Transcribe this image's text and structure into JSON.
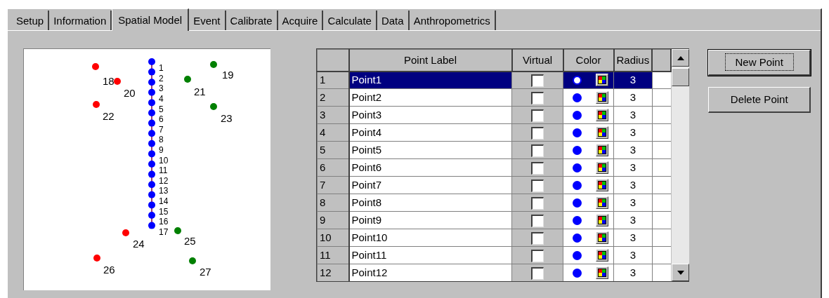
{
  "tabs": [
    {
      "label": "Setup",
      "selected": false
    },
    {
      "label": "Information",
      "selected": false
    },
    {
      "label": "Spatial Model",
      "selected": true
    },
    {
      "label": "Event",
      "selected": false
    },
    {
      "label": "Calibrate",
      "selected": false
    },
    {
      "label": "Acquire",
      "selected": false
    },
    {
      "label": "Calculate",
      "selected": false
    },
    {
      "label": "Data",
      "selected": false
    },
    {
      "label": "Anthropometrics",
      "selected": false
    }
  ],
  "model_view": {
    "points": [
      {
        "label": "1",
        "color": "#0000ff"
      },
      {
        "label": "2",
        "color": "#0000ff"
      },
      {
        "label": "3",
        "color": "#0000ff"
      },
      {
        "label": "4",
        "color": "#0000ff"
      },
      {
        "label": "5",
        "color": "#0000ff"
      },
      {
        "label": "6",
        "color": "#0000ff"
      },
      {
        "label": "7",
        "color": "#0000ff"
      },
      {
        "label": "8",
        "color": "#0000ff"
      },
      {
        "label": "9",
        "color": "#0000ff"
      },
      {
        "label": "10",
        "color": "#0000ff"
      },
      {
        "label": "11",
        "color": "#0000ff"
      },
      {
        "label": "12",
        "color": "#0000ff"
      },
      {
        "label": "13",
        "color": "#0000ff"
      },
      {
        "label": "14",
        "color": "#0000ff"
      },
      {
        "label": "15",
        "color": "#0000ff"
      },
      {
        "label": "16",
        "color": "#0000ff"
      },
      {
        "label": "17",
        "color": "#0000ff"
      },
      {
        "label": "18",
        "color": "#ff0000"
      },
      {
        "label": "19",
        "color": "#008000"
      },
      {
        "label": "20",
        "color": "#ff0000"
      },
      {
        "label": "21",
        "color": "#008000"
      },
      {
        "label": "22",
        "color": "#ff0000"
      },
      {
        "label": "23",
        "color": "#008000"
      },
      {
        "label": "24",
        "color": "#ff0000"
      },
      {
        "label": "25",
        "color": "#008000"
      },
      {
        "label": "26",
        "color": "#ff0000"
      },
      {
        "label": "27",
        "color": "#008000"
      }
    ]
  },
  "grid": {
    "columns": [
      "Point Label",
      "Virtual",
      "Color",
      "Radius"
    ],
    "rows": [
      {
        "number": "1",
        "label": "Point1",
        "virtual": false,
        "color": "#0000ff",
        "radius": "3",
        "selected": true
      },
      {
        "number": "2",
        "label": "Point2",
        "virtual": false,
        "color": "#0000ff",
        "radius": "3",
        "selected": false
      },
      {
        "number": "3",
        "label": "Point3",
        "virtual": false,
        "color": "#0000ff",
        "radius": "3",
        "selected": false
      },
      {
        "number": "4",
        "label": "Point4",
        "virtual": false,
        "color": "#0000ff",
        "radius": "3",
        "selected": false
      },
      {
        "number": "5",
        "label": "Point5",
        "virtual": false,
        "color": "#0000ff",
        "radius": "3",
        "selected": false
      },
      {
        "number": "6",
        "label": "Point6",
        "virtual": false,
        "color": "#0000ff",
        "radius": "3",
        "selected": false
      },
      {
        "number": "7",
        "label": "Point7",
        "virtual": false,
        "color": "#0000ff",
        "radius": "3",
        "selected": false
      },
      {
        "number": "8",
        "label": "Point8",
        "virtual": false,
        "color": "#0000ff",
        "radius": "3",
        "selected": false
      },
      {
        "number": "9",
        "label": "Point9",
        "virtual": false,
        "color": "#0000ff",
        "radius": "3",
        "selected": false
      },
      {
        "number": "10",
        "label": "Point10",
        "virtual": false,
        "color": "#0000ff",
        "radius": "3",
        "selected": false
      },
      {
        "number": "11",
        "label": "Point11",
        "virtual": false,
        "color": "#0000ff",
        "radius": "3",
        "selected": false
      },
      {
        "number": "12",
        "label": "Point12",
        "virtual": false,
        "color": "#0000ff",
        "radius": "3",
        "selected": false
      }
    ]
  },
  "buttons": [
    {
      "label": "New Point",
      "default": true
    },
    {
      "label": "Delete Point",
      "default": false
    }
  ]
}
